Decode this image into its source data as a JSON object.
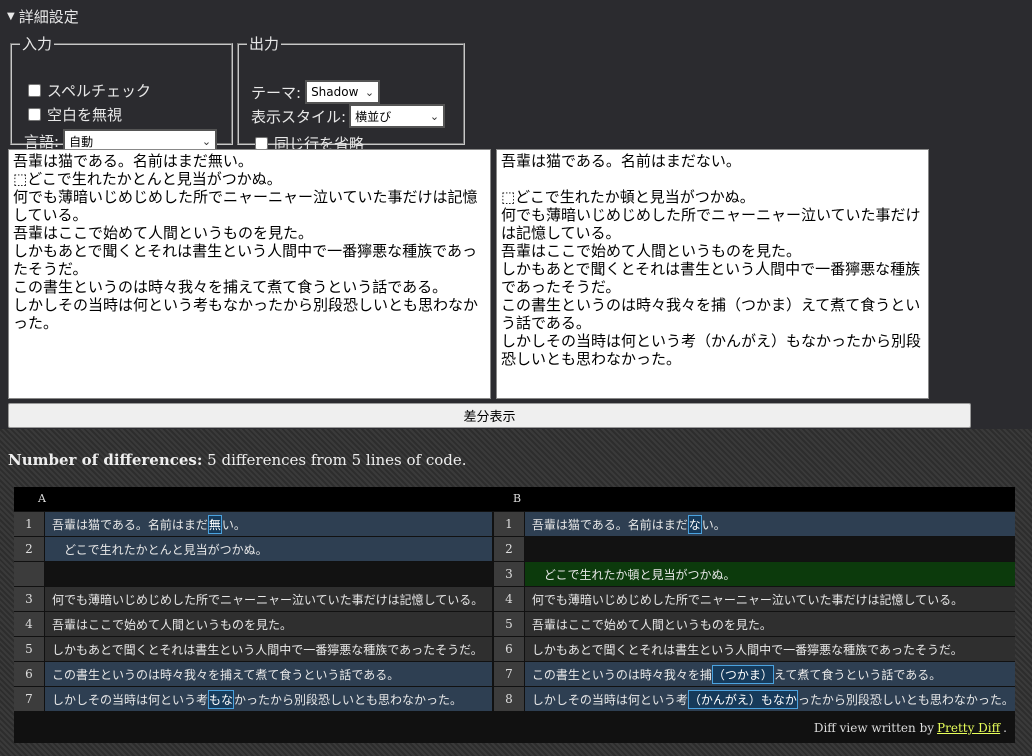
{
  "summary": {
    "label": "詳細設定"
  },
  "input": {
    "legend": "入力",
    "spellcheck_label": "スペルチェック",
    "ignore_ws_label": "空白を無視",
    "lang_label": "言語:",
    "lang_value": "自動"
  },
  "output": {
    "legend": "出力",
    "theme_label": "テーマ:",
    "theme_value": "Shadow",
    "style_label": "表示スタイル:",
    "style_value": "横並び",
    "omit_label": "同じ行を省略"
  },
  "text_a": "吾輩は猫である。名前はまだ無い。\n⬚どこで生れたかとんと見当がつかぬ。\n何でも薄暗いじめじめした所でニャーニャー泣いていた事だけは記憶している。\n吾輩はここで始めて人間というものを見た。\nしかもあとで聞くとそれは書生という人間中で一番獰悪な種族であったそうだ。\nこの書生というのは時々我々を捕えて煮て食うという話である。\nしかしその当時は何という考もなかったから別段恐しいとも思わなかった。",
  "text_b": "吾輩は猫である。名前はまだない。\n\n⬚どこで生れたか頓と見当がつかぬ。\n何でも薄暗いじめじめした所でニャーニャー泣いていた事だけは記憶している。\n吾輩はここで始めて人間というものを見た。\nしかもあとで聞くとそれは書生という人間中で一番獰悪な種族であったそうだ。\nこの書生というのは時々我々を捕（つかま）えて煮て食うという話である。\nしかしその当時は何という考（かんがえ）もなかったから別段恐しいとも思わなかった。",
  "diff_button": "差分表示",
  "report": {
    "count_label": "Number of differences:",
    "count_text": "5 differences from 5 lines of code.",
    "head_a": "A",
    "head_b": "B",
    "footer_text": "Diff view written by",
    "footer_link": "Pretty Diff",
    "footer_end": "."
  },
  "rows": [
    {
      "a_num": "1",
      "a_pre": "吾輩は猫である。名前はまだ",
      "a_hl": "無",
      "a_post": "い。",
      "b_num": "1",
      "b_pre": "吾輩は猫である。名前はまだ",
      "b_hl": "な",
      "b_post": "い。",
      "type": "changed"
    },
    {
      "a_num": "2",
      "a_pre": "　どこで生れたかとんと見当がつかぬ。",
      "a_hl": "",
      "a_post": "",
      "b_num": "2",
      "b_pre": "",
      "b_hl": "",
      "b_post": "",
      "type": "changed-emptyB"
    },
    {
      "a_num": "",
      "a_pre": "",
      "a_hl": "",
      "a_post": "",
      "b_num": "3",
      "b_pre": "　どこで生れたか頓と見当がつかぬ。",
      "b_hl": "",
      "b_post": "",
      "type": "insert"
    },
    {
      "a_num": "3",
      "a_pre": "何でも薄暗いじめじめした所でニャーニャー泣いていた事だけは記憶している。",
      "a_hl": "",
      "a_post": "",
      "b_num": "4",
      "b_pre": "何でも薄暗いじめじめした所でニャーニャー泣いていた事だけは記憶している。",
      "b_hl": "",
      "b_post": "",
      "type": "equal"
    },
    {
      "a_num": "4",
      "a_pre": "吾輩はここで始めて人間というものを見た。",
      "a_hl": "",
      "a_post": "",
      "b_num": "5",
      "b_pre": "吾輩はここで始めて人間というものを見た。",
      "b_hl": "",
      "b_post": "",
      "type": "equal"
    },
    {
      "a_num": "5",
      "a_pre": "しかもあとで聞くとそれは書生という人間中で一番獰悪な種族であったそうだ。",
      "a_hl": "",
      "a_post": "",
      "b_num": "6",
      "b_pre": "しかもあとで聞くとそれは書生という人間中で一番獰悪な種族であったそうだ。",
      "b_hl": "",
      "b_post": "",
      "type": "equal"
    },
    {
      "a_num": "6",
      "a_pre": "この書生というのは時々我々を捕",
      "a_hl": "",
      "a_post": "えて煮て食うという話である。",
      "b_num": "7",
      "b_pre": "この書生というのは時々我々を捕",
      "b_hl": "（つかま）",
      "b_post": "えて煮て食うという話である。",
      "type": "changed"
    },
    {
      "a_num": "7",
      "a_pre": "しかしその当時は何という考",
      "a_hl": "もな",
      "a_post": "かったから別段恐しいとも思わなかった。",
      "b_num": "8",
      "b_pre": "しかしその当時は何という考",
      "b_hl": "（かんがえ）もなか",
      "b_post": "ったから別段恐しいとも思わなかった。",
      "type": "changed"
    }
  ]
}
